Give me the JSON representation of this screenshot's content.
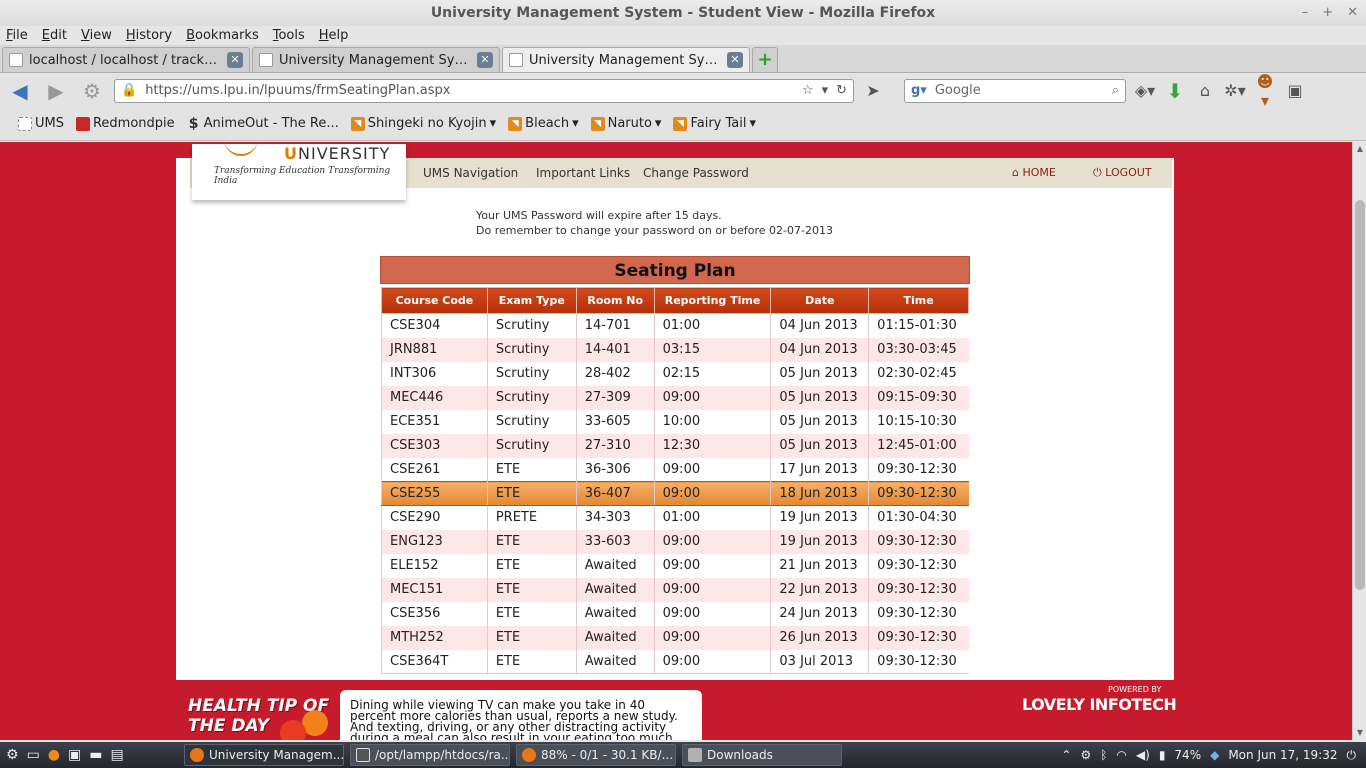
{
  "window": {
    "title": "University Management System - Student View - Mozilla Firefox",
    "controls": [
      "–",
      "+",
      "✕"
    ]
  },
  "menu": [
    "File",
    "Edit",
    "View",
    "History",
    "Bookmarks",
    "Tools",
    "Help"
  ],
  "tabs": [
    {
      "label": "localhost / localhost / trackstar ...",
      "active": false
    },
    {
      "label": "University Management Syste...",
      "active": false
    },
    {
      "label": "University Management Syste...",
      "active": true
    }
  ],
  "toolbar": {
    "url": "https://ums.lpu.in/lpuums/frmSeatingPlan.aspx",
    "search_placeholder": "Google"
  },
  "bookmarks": [
    {
      "label": "UMS",
      "icon": "plain",
      "dropdown": false
    },
    {
      "label": "Redmondpie",
      "icon": "red",
      "dropdown": false
    },
    {
      "label": "AnimeOut - The Re...",
      "icon": "s",
      "dropdown": false
    },
    {
      "label": "Shingeki no Kyojin",
      "icon": "rss",
      "dropdown": true
    },
    {
      "label": "Bleach",
      "icon": "rss",
      "dropdown": true
    },
    {
      "label": "Naruto",
      "icon": "rss",
      "dropdown": true
    },
    {
      "label": "Fairy Tail",
      "icon": "rss",
      "dropdown": true
    }
  ],
  "site": {
    "logo_text": "NIVERSITY",
    "logo_letter": "U",
    "tagline": "Transforming Education Transforming India",
    "header_fragment": "UNIVERSITY MANAGEMENT SYSTEM",
    "nav": [
      "UMS Navigation",
      "Important Links",
      "Change Password"
    ],
    "home": "HOME",
    "logout": "LOGOUT",
    "notice_line1": "Your UMS Password will expire after 15 days.",
    "notice_line2": "Do remember to change your password on or before 02-07-2013"
  },
  "seating": {
    "title": "Seating Plan",
    "columns": [
      "Course Code",
      "Exam Type",
      "Room No",
      "Reporting Time",
      "Date",
      "Time"
    ],
    "rows": [
      [
        "CSE304",
        "Scrutiny",
        "14-701",
        "01:00",
        "04 Jun 2013",
        "01:15-01:30"
      ],
      [
        "JRN881",
        "Scrutiny",
        "14-401",
        "03:15",
        "04 Jun 2013",
        "03:30-03:45"
      ],
      [
        "INT306",
        "Scrutiny",
        "28-402",
        "02:15",
        "05 Jun 2013",
        "02:30-02:45"
      ],
      [
        "MEC446",
        "Scrutiny",
        "27-309",
        "09:00",
        "05 Jun 2013",
        "09:15-09:30"
      ],
      [
        "ECE351",
        "Scrutiny",
        "33-605",
        "10:00",
        "05 Jun 2013",
        "10:15-10:30"
      ],
      [
        "CSE303",
        "Scrutiny",
        "27-310",
        "12:30",
        "05 Jun 2013",
        "12:45-01:00"
      ],
      [
        "CSE261",
        "ETE",
        "36-306",
        "09:00",
        "17 Jun 2013",
        "09:30-12:30"
      ],
      [
        "CSE255",
        "ETE",
        "36-407",
        "09:00",
        "18 Jun 2013",
        "09:30-12:30"
      ],
      [
        "CSE290",
        "PRETE",
        "34-303",
        "01:00",
        "19 Jun 2013",
        "01:30-04:30"
      ],
      [
        "ENG123",
        "ETE",
        "33-603",
        "09:00",
        "19 Jun 2013",
        "09:30-12:30"
      ],
      [
        "ELE152",
        "ETE",
        "Awaited",
        "09:00",
        "21 Jun 2013",
        "09:30-12:30"
      ],
      [
        "MEC151",
        "ETE",
        "Awaited",
        "09:00",
        "22 Jun 2013",
        "09:30-12:30"
      ],
      [
        "CSE356",
        "ETE",
        "Awaited",
        "09:00",
        "24 Jun 2013",
        "09:30-12:30"
      ],
      [
        "MTH252",
        "ETE",
        "Awaited",
        "09:00",
        "26 Jun 2013",
        "09:30-12:30"
      ],
      [
        "CSE364T",
        "ETE",
        "Awaited",
        "09:00",
        "03 Jul 2013",
        "09:30-12:30"
      ]
    ],
    "highlighted_row": 7
  },
  "footer": {
    "tip_label_1": "HEALTH TIP OF",
    "tip_label_2": "THE DAY",
    "tip_text": "Dining while viewing TV can make you take in 40 percent more calories than usual, reports a new study. And texting, driving, or any other distracting activity during a meal can also result in your eating too much. Instead, make each meal",
    "powered_by": "POWERED BY",
    "company": "LOVELY INFOTECH"
  },
  "taskbar": {
    "tasks": [
      {
        "label": "University Managem...",
        "icon": "firefox",
        "active": true
      },
      {
        "label": "/opt/lampp/htdocs/ra...",
        "icon": "term",
        "active": false
      },
      {
        "label": "88% - 0/1 - 30.1 KB/...",
        "icon": "firefox",
        "active": false
      },
      {
        "label": "Downloads",
        "icon": "folder",
        "active": false
      }
    ],
    "battery": "74%",
    "clock": "Mon Jun 17, 19:32"
  },
  "colors": {
    "page_bg": "#c51b2c",
    "table_header": "#c03a10",
    "seating_title_bg": "#d1684e",
    "highlight_row": "#e98c36",
    "alt_row": "#fde6e6"
  }
}
